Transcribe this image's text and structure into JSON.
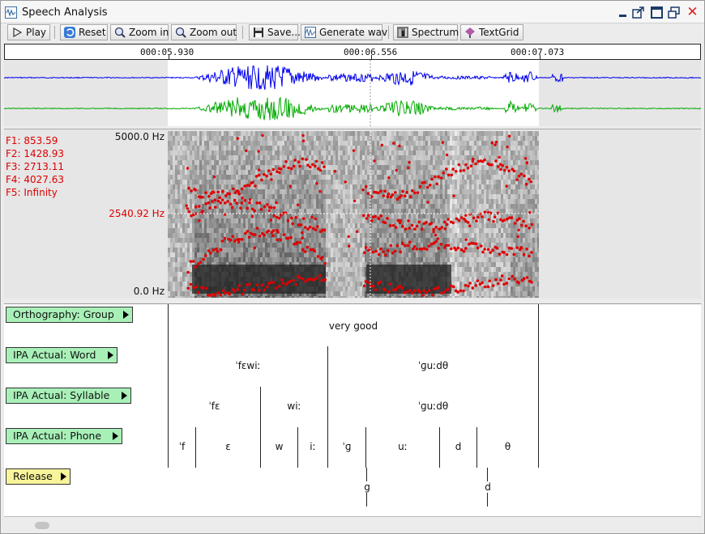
{
  "window": {
    "title": "Speech Analysis"
  },
  "toolbar": {
    "play": "Play",
    "reset": "Reset",
    "zoom_in": "Zoom in",
    "zoom_out": "Zoom out",
    "save": "Save...",
    "generate_wav": "Generate wav",
    "spectrum": "Spectrum",
    "textgrid": "TextGrid"
  },
  "timeline": {
    "t1": "000:05.930",
    "t2": "000:06.556",
    "t3": "000:07.073"
  },
  "formants": {
    "f1": "F1: 853.59",
    "f2": "F2: 1428.93",
    "f3": "F3: 2713.11",
    "f4": "F4: 4027.63",
    "f5": "F5: Infinity"
  },
  "spectrogram": {
    "max_hz": "5000.0 Hz",
    "cursor_hz": "2540.92 Hz",
    "min_hz": "0.0 Hz"
  },
  "colors": {
    "formant": "#e00000",
    "wave_ch1": "#0000ee",
    "wave_ch2": "#00aa00",
    "tier_green": "#a8f0b8",
    "tier_yellow": "#f8f49a"
  },
  "tiers": {
    "orthography": {
      "label": "Orthography: Group",
      "segments": [
        "very good"
      ]
    },
    "word": {
      "label": "IPA Actual: Word",
      "segments": [
        "ˈfɛwiː",
        "ˈɡuːdθ"
      ]
    },
    "syllable": {
      "label": "IPA Actual: Syllable",
      "segments": [
        "ˈfɛ",
        "wiː",
        "ˈɡuːdθ"
      ]
    },
    "phone": {
      "label": "IPA Actual: Phone",
      "segments": [
        "ˈf",
        "ɛ",
        "w",
        "iː",
        "ˈɡ",
        "uː",
        "d",
        "θ"
      ]
    },
    "release": {
      "label": "Release",
      "segments": [
        "g",
        "d"
      ]
    }
  }
}
